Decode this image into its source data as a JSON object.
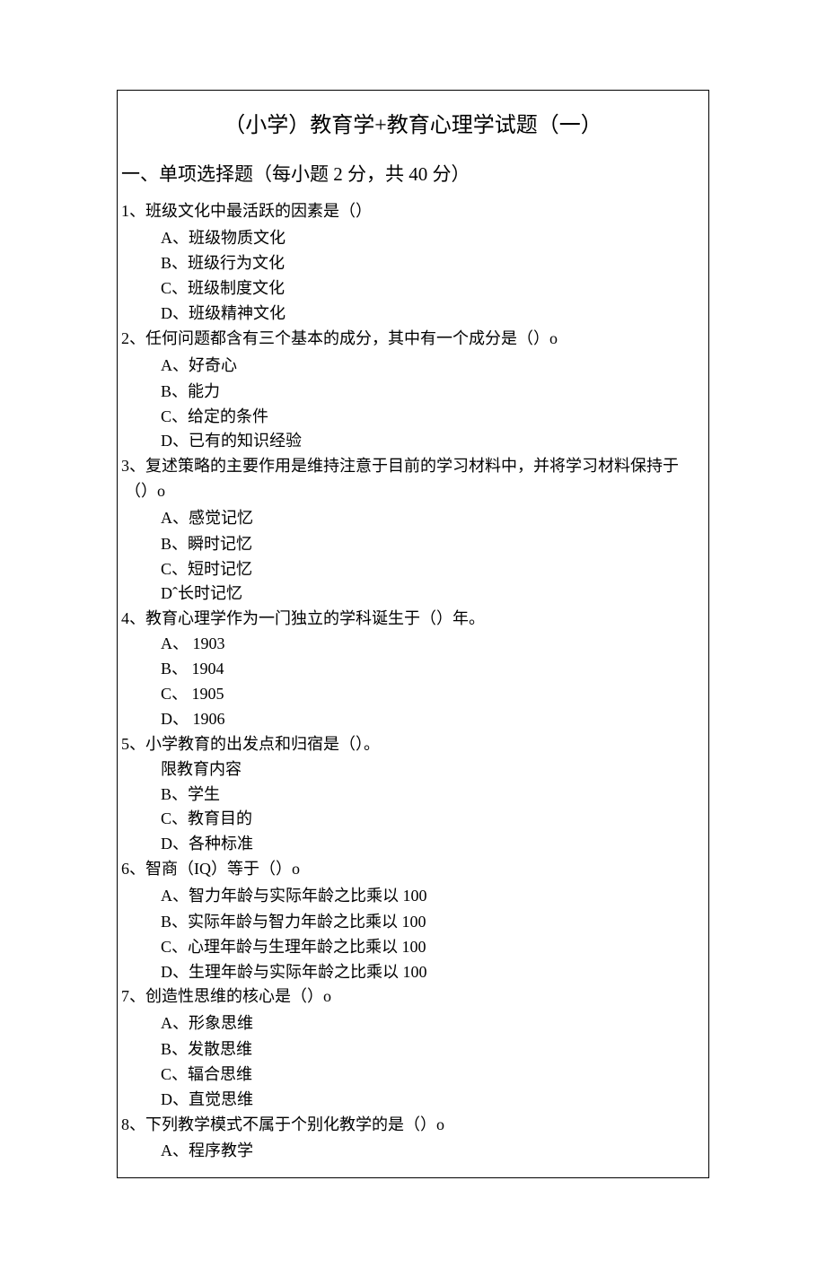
{
  "title": "（小学）教育学+教育心理学试题（一）",
  "section1": "一、单项选择题（每小题 2 分，共 40 分）",
  "q1": {
    "stem": "1、班级文化中最活跃的因素是（）",
    "a": "A、班级物质文化",
    "b": "B、班级行为文化",
    "c": "C、班级制度文化",
    "d": "D、班级精神文化"
  },
  "q2": {
    "stem": "2、任何问题都含有三个基本的成分，其中有一个成分是（）o",
    "a": "A、好奇心",
    "b": "B、能力",
    "c": "C、给定的条件",
    "d": "D、已有的知识经验"
  },
  "q3": {
    "stem1": "3、复述策略的主要作用是维持注意于目前的学习材料中，并将学习材料保持于",
    "stem2": "（）o",
    "a": "A、感觉记忆",
    "b": "B、瞬时记忆",
    "c": "C、短时记忆",
    "d": "Dˆ长时记忆"
  },
  "q4": {
    "stem": "4、教育心理学作为一门独立的学科诞生于（）年。",
    "a": "A、 1903",
    "b": "B、 1904",
    "c": "C、 1905",
    "d": "D、 1906"
  },
  "q5": {
    "stem": "5、小学教育的出发点和归宿是（）。",
    "a": "限教育内容",
    "b": "B、学生",
    "c": "C、教育目的",
    "d": "D、各种标准"
  },
  "q6": {
    "stem": "6、智商（IQ）等于（）o",
    "a": "A、智力年龄与实际年龄之比乘以 100",
    "b": "B、实际年龄与智力年龄之比乘以 100",
    "c": "C、心理年龄与生理年龄之比乘以 100",
    "d": "D、生理年龄与实际年龄之比乘以 100"
  },
  "q7": {
    "stem": "7、创造性思维的核心是（）o",
    "a": "A、形象思维",
    "b": "B、发散思维",
    "c": "C、辐合思维",
    "d": "D、直觉思维"
  },
  "q8": {
    "stem": "8、下列教学模式不属于个别化教学的是（）o",
    "a": "A、程序教学"
  }
}
